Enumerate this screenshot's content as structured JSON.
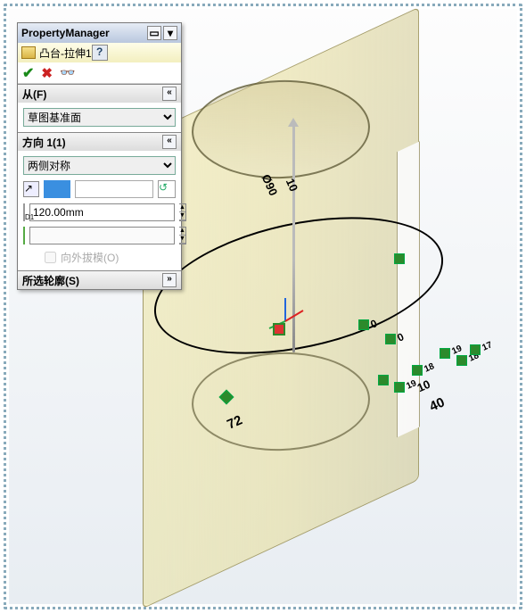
{
  "panel": {
    "title": "PropertyManager",
    "feature_name": "凸台-拉伸1",
    "help": "?",
    "ok": "✔",
    "cancel": "✖",
    "pin_tip": "↺"
  },
  "from": {
    "header": "从(F)",
    "value": "草图基准面"
  },
  "dir1": {
    "header": "方向 1(1)",
    "end_condition": "两侧对称",
    "depth_label": "D1",
    "depth_value": "120.00mm",
    "draft_outward": "向外拔模(O)"
  },
  "contour": {
    "header": "所选轮廓(S)"
  },
  "chev": {
    "up": "«",
    "down": "»"
  },
  "model": {
    "dims": {
      "d72": "72",
      "d40": "40",
      "d10l": "10",
      "d10r": "10",
      "d90": "Ø90"
    },
    "rel": {
      "h0a": "0",
      "h0b": "0",
      "r18a": "18",
      "r18b": "18",
      "r19a": "19",
      "r19b": "19",
      "r17": "17"
    }
  }
}
